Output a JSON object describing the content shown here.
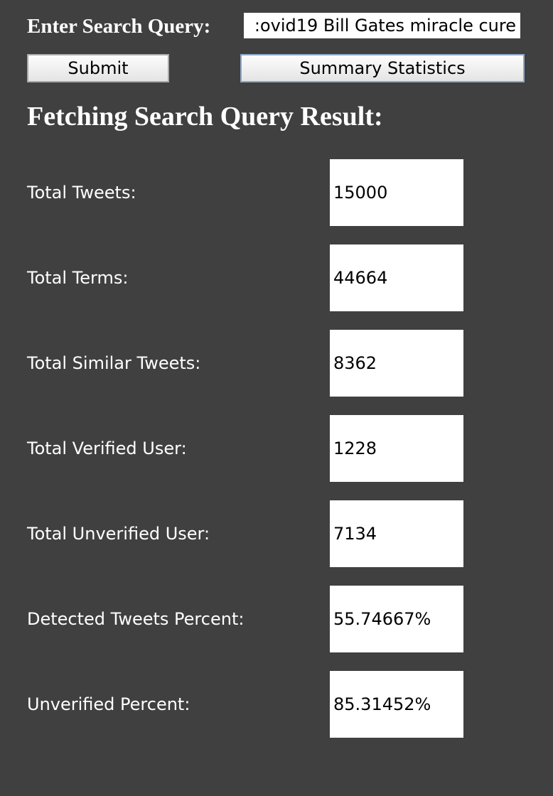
{
  "search": {
    "label": "Enter Search Query:",
    "value": ":ovid19 Bill Gates miracle cure"
  },
  "buttons": {
    "submit_label": "Submit",
    "summary_label": "Summary Statistics"
  },
  "results": {
    "heading": "Fetching Search Query Result:",
    "rows": [
      {
        "label": "Total Tweets:",
        "value": "15000"
      },
      {
        "label": "Total Terms:",
        "value": "44664"
      },
      {
        "label": "Total Similar Tweets:",
        "value": "8362"
      },
      {
        "label": "Total Verified User:",
        "value": "1228"
      },
      {
        "label": "Total Unverified User:",
        "value": "7134"
      },
      {
        "label": "Detected Tweets Percent:",
        "value": "55.74667%"
      },
      {
        "label": "Unverified Percent:",
        "value": "85.31452%"
      }
    ]
  },
  "colors": {
    "background": "#404040",
    "text": "#ffffff",
    "field_background": "#ffffff"
  }
}
